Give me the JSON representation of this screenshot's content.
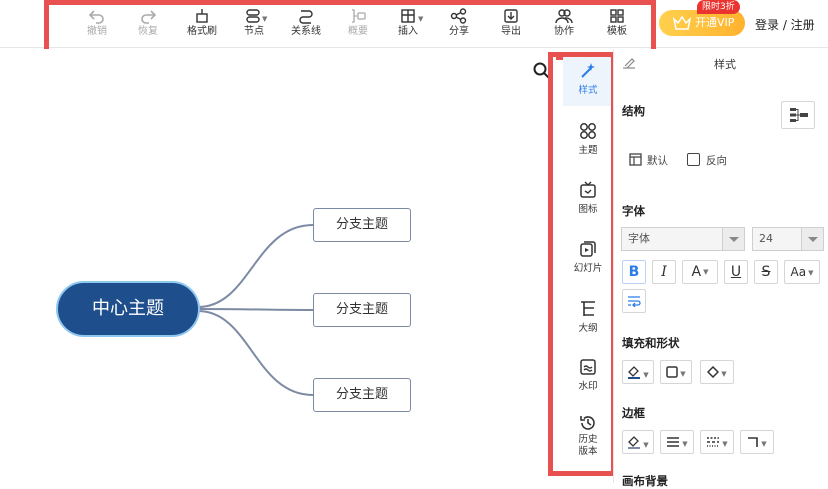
{
  "toolbar": {
    "undo": "撤销",
    "redo": "恢复",
    "format_painter": "格式刷",
    "node": "节点",
    "relation_line": "关系线",
    "summary": "概要",
    "insert": "插入",
    "share": "分享",
    "export": "导出",
    "collaborate": "协作",
    "template": "模板"
  },
  "header": {
    "vip_label": "开通VIP",
    "vip_badge": "限时3折",
    "login": "登录 / 注册"
  },
  "mindmap": {
    "central": "中心主题",
    "branches": [
      "分支主题",
      "分支主题",
      "分支主题"
    ]
  },
  "side_tabs": {
    "style": "样式",
    "theme": "主题",
    "icon": "图标",
    "slides": "幻灯片",
    "outline": "大纲",
    "watermark": "水印",
    "history_line1": "历史",
    "history_line2": "版本"
  },
  "panel": {
    "title": "样式",
    "structure_title": "结构",
    "default_label": "默认",
    "reverse_label": "反向",
    "font_title": "字体",
    "font_family": "字体",
    "font_size": "24",
    "fill_title": "填充和形状",
    "border_title": "边框",
    "canvas_bg_title": "画布背景"
  },
  "colors": {
    "central_fill": "#1f4e8c",
    "accent": "#2b7de9",
    "highlight": "#e8514f",
    "vip": "#ffb22e"
  }
}
